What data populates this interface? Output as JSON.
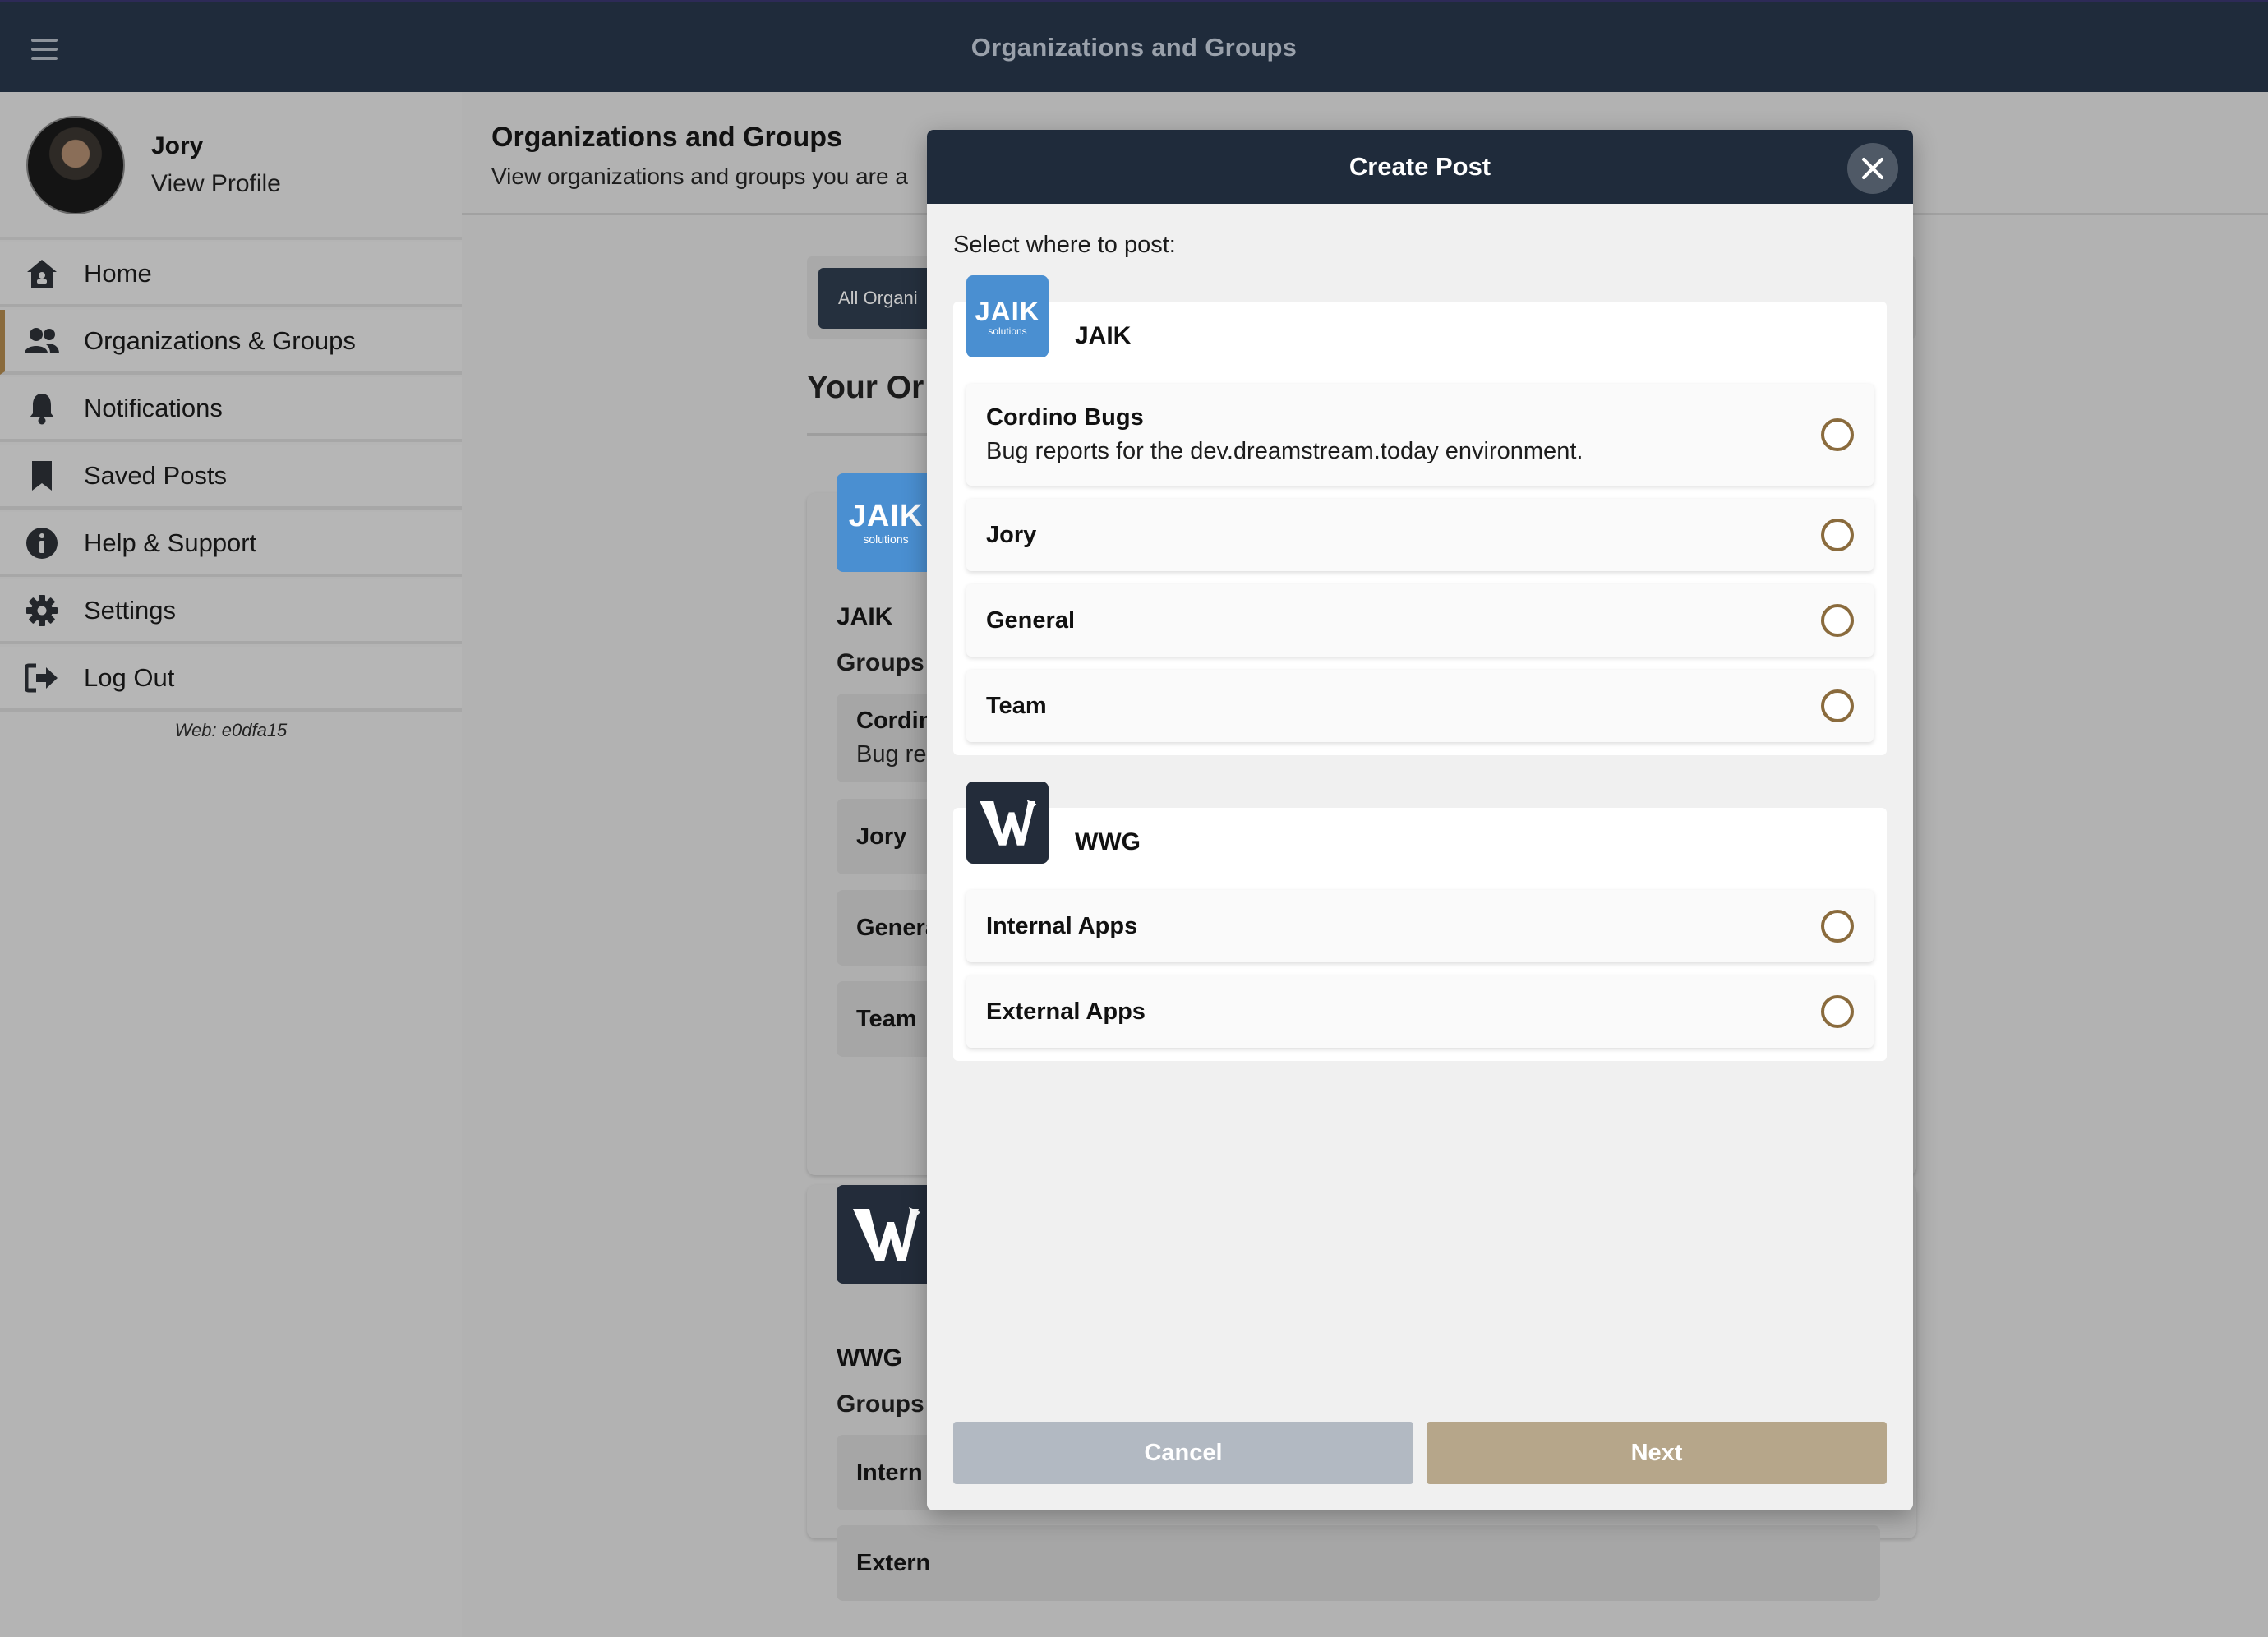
{
  "topbar": {
    "title": "Organizations and Groups",
    "menu_icon": "hamburger-icon"
  },
  "profile": {
    "name": "Jory",
    "link": "View Profile"
  },
  "sidebar": {
    "items": [
      {
        "label": "Home",
        "icon": "home-icon"
      },
      {
        "label": "Organizations & Groups",
        "icon": "users-icon",
        "active": true
      },
      {
        "label": "Notifications",
        "icon": "bell-icon"
      },
      {
        "label": "Saved Posts",
        "icon": "bookmark-icon"
      },
      {
        "label": "Help & Support",
        "icon": "info-icon"
      },
      {
        "label": "Settings",
        "icon": "gear-icon"
      },
      {
        "label": "Log Out",
        "icon": "logout-icon"
      }
    ],
    "version": "Web: e0dfa15"
  },
  "main": {
    "title": "Organizations and Groups",
    "subtitle": "View organizations and groups you are a",
    "filter_tab": "All Organi",
    "section_title": "Your Or",
    "orgs": [
      {
        "name": "JAIK",
        "groups_label": "Groups",
        "groups": [
          {
            "name": "Cordin",
            "desc": "Bug rep"
          },
          {
            "name": "Jory"
          },
          {
            "name": "Genera"
          },
          {
            "name": "Team"
          }
        ]
      },
      {
        "name": "WWG",
        "groups_label": "Groups",
        "groups": [
          {
            "name": "Intern"
          },
          {
            "name": "Extern"
          }
        ]
      }
    ]
  },
  "logos": {
    "jaik_word": "JAIK",
    "jaik_sub": "solutions",
    "jaik_color": "#4a8fd1",
    "wwg_color": "#232c3a"
  },
  "modal": {
    "title": "Create Post",
    "prompt": "Select where to post:",
    "orgs": [
      {
        "name": "JAIK",
        "groups": [
          {
            "name": "Cordino Bugs",
            "desc": "Bug reports for the dev.dreamstream.today environment."
          },
          {
            "name": "Jory"
          },
          {
            "name": "General"
          },
          {
            "name": "Team"
          }
        ]
      },
      {
        "name": "WWG",
        "groups": [
          {
            "name": "Internal Apps"
          },
          {
            "name": "External Apps"
          }
        ]
      }
    ],
    "cancel_label": "Cancel",
    "next_label": "Next"
  },
  "colors": {
    "header": "#1f2b3b",
    "accent": "#8a6b3d",
    "next_button": "#b6a68a",
    "cancel_button": "#b2b9c2"
  }
}
